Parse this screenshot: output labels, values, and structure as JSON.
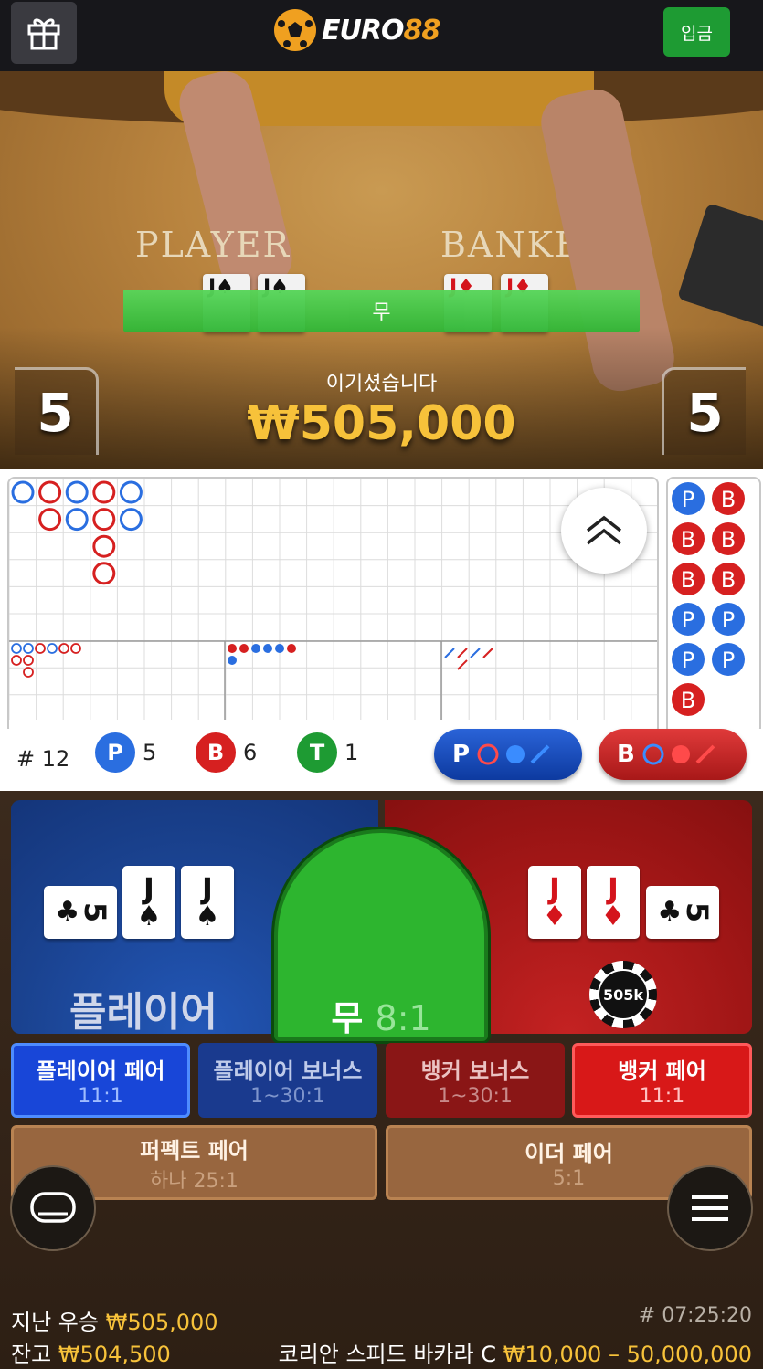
{
  "header": {
    "logo_text": "EURO",
    "logo_num": "88",
    "deposit_label": "입금"
  },
  "video": {
    "player_word": "PLAYER",
    "banker_word": "BANKE",
    "result_strip": "무",
    "player_score": "5",
    "banker_score": "5",
    "win_message": "이기셨습니다",
    "win_amount": "₩505,000"
  },
  "stats": {
    "round_label": "# 12",
    "player_letter": "P",
    "player_count": "5",
    "banker_letter": "B",
    "banker_count": "6",
    "tie_letter": "T",
    "tie_count": "1",
    "predict_player_letter": "P",
    "predict_banker_letter": "B"
  },
  "colors": {
    "player": "#2a6ee0",
    "banker": "#d62020",
    "tie": "#1e9b33",
    "gold": "#f7c23a"
  },
  "bets": {
    "player_label": "플레이어",
    "tie_label": "무",
    "tie_odds": "8:1",
    "chip_label": "505k",
    "player_pair": {
      "label": "플레이어 페어",
      "odds": "11:1"
    },
    "player_bonus": {
      "label": "플레이어 보너스",
      "odds": "1~30:1"
    },
    "banker_bonus": {
      "label": "뱅커 보너스",
      "odds": "1~30:1"
    },
    "banker_pair": {
      "label": "뱅커 페어",
      "odds": "11:1"
    },
    "perfect_pair": {
      "label": "퍼펙트 페어",
      "odds": "하나 25:1"
    },
    "either_pair": {
      "label": "이더 페어",
      "odds": "5:1"
    }
  },
  "cards": {
    "player": [
      {
        "rank": "5",
        "suit": "♣",
        "color": "black",
        "sideways": true
      },
      {
        "rank": "J",
        "suit": "♠",
        "color": "black",
        "sideways": false
      },
      {
        "rank": "J",
        "suit": "♠",
        "color": "black",
        "sideways": false
      }
    ],
    "banker": [
      {
        "rank": "J",
        "suit": "♦",
        "color": "red",
        "sideways": false
      },
      {
        "rank": "J",
        "suit": "♦",
        "color": "red",
        "sideways": false
      },
      {
        "rank": "5",
        "suit": "♣",
        "color": "black",
        "sideways": true
      }
    ]
  },
  "footer": {
    "last_win_label": "지난 우승",
    "last_win_amount": "₩505,000",
    "balance_label": "잔고",
    "balance_amount": "₩504,500",
    "time": "# 07:25:20",
    "table_name": "코리안 스피드 바카라 C",
    "limits": "₩10,000 – 50,000,000"
  },
  "roadmap": {
    "bead_road": [
      {
        "col": 0,
        "row": 0,
        "outcome": "P"
      },
      {
        "col": 1,
        "row": 0,
        "outcome": "B"
      },
      {
        "col": 1,
        "row": 1,
        "outcome": "B"
      },
      {
        "col": 2,
        "row": 0,
        "outcome": "P"
      },
      {
        "col": 2,
        "row": 1,
        "outcome": "P"
      },
      {
        "col": 3,
        "row": 0,
        "outcome": "B"
      },
      {
        "col": 3,
        "row": 1,
        "outcome": "B"
      },
      {
        "col": 3,
        "row": 2,
        "outcome": "B"
      },
      {
        "col": 3,
        "row": 3,
        "outcome": "B"
      },
      {
        "col": 4,
        "row": 0,
        "outcome": "P"
      },
      {
        "col": 4,
        "row": 1,
        "outcome": "P"
      }
    ],
    "side_road": [
      {
        "col": 0,
        "row": 0,
        "outcome": "P"
      },
      {
        "col": 1,
        "row": 0,
        "outcome": "B"
      },
      {
        "col": 0,
        "row": 1,
        "outcome": "B"
      },
      {
        "col": 1,
        "row": 1,
        "outcome": "B"
      },
      {
        "col": 0,
        "row": 2,
        "outcome": "B"
      },
      {
        "col": 1,
        "row": 2,
        "outcome": "B"
      },
      {
        "col": 0,
        "row": 3,
        "outcome": "P"
      },
      {
        "col": 1,
        "row": 3,
        "outcome": "P"
      },
      {
        "col": 0,
        "row": 4,
        "outcome": "P"
      },
      {
        "col": 1,
        "row": 4,
        "outcome": "P"
      },
      {
        "col": 0,
        "row": 5,
        "outcome": "B"
      }
    ]
  }
}
